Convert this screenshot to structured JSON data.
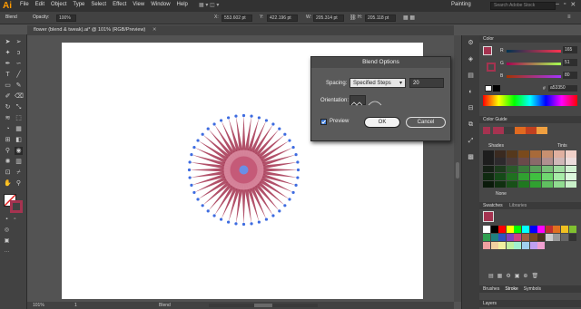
{
  "menubar": {
    "logo": "Ai",
    "items": [
      "File",
      "Edit",
      "Object",
      "Type",
      "Select",
      "Effect",
      "View",
      "Window",
      "Help"
    ],
    "workspace": "Painting",
    "search_placeholder": "Search Adobe Stock"
  },
  "control_bar": {
    "selection_label": "Blend",
    "opacity_label": "Opacity:",
    "opacity_value": "100%",
    "x_label": "X:",
    "x_value": "553.602 pt",
    "y_label": "Y:",
    "y_value": "422.196 pt",
    "w_label": "W:",
    "w_value": "205.314 pt",
    "h_label": "H:",
    "h_value": "205.118 pt"
  },
  "document": {
    "tab_title": "flower (blend & tweak).ai* @ 101% (RGB/Preview)"
  },
  "status": {
    "zoom": "101%",
    "page": "1",
    "tool_name": "Blend"
  },
  "dialog": {
    "title": "Blend Options",
    "spacing_label": "Spacing:",
    "spacing_value": "Specified Steps",
    "steps_value": "20",
    "orientation_label": "Orientation:",
    "preview_label": "Preview",
    "preview_checked": true,
    "ok_label": "OK",
    "cancel_label": "Cancel"
  },
  "color_panel": {
    "title": "Color",
    "r_label": "R",
    "r_value": "165",
    "g_label": "G",
    "g_value": "51",
    "b_label": "B",
    "b_value": "80",
    "hex_prefix": "#",
    "hex_value": "a53350",
    "fill_color": "#a53350"
  },
  "color_guide_panel": {
    "title": "Color Guide",
    "shades_label": "Shades",
    "tints_label": "Tints",
    "none_label": "None"
  },
  "swatches_panel": {
    "tab_swatches": "Swatches",
    "tab_libraries": "Libraries"
  },
  "bottom_tabs": {
    "brushes": "Brushes",
    "stroke": "Stroke",
    "symbols": "Symbols",
    "layers": "Layers"
  },
  "colors": {
    "accent": "#ff9a00",
    "flower_petal": "#a53350",
    "flower_center": "#6a8fe6",
    "anchor": "#3d6be0"
  }
}
